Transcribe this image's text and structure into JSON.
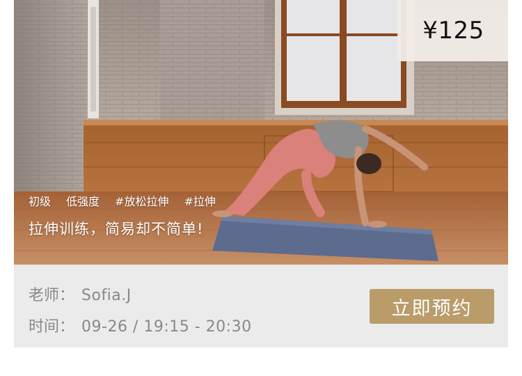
{
  "course": {
    "price": "¥125",
    "tags": [
      "初级",
      "低强度",
      "#放松拉伸",
      "#拉伸"
    ],
    "headline": "拉伸训练，简易却不简单!",
    "teacher_label": "老师：",
    "teacher_name": "Sofia.J",
    "time_label": "时间：",
    "time_value": "09-26 / 19:15 - 20:30",
    "book_label": "立即预约"
  },
  "colors": {
    "accent": "#b99c69",
    "card_bg": "#ebebeb",
    "muted_text": "#888888"
  }
}
